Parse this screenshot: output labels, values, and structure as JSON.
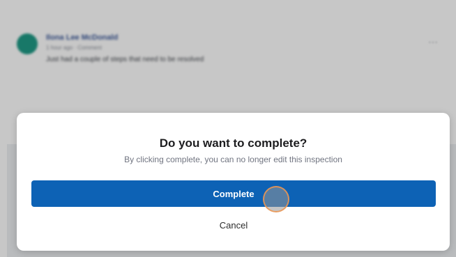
{
  "background": {
    "author": "Ilona Lee McDonald",
    "meta": "1 hour ago · Comment",
    "comment": "Just had a couple of steps that need to be resolved",
    "more_icon": "more-icon"
  },
  "dialog": {
    "title": "Do you want to complete?",
    "subtitle": "By clicking complete, you can no longer edit this inspection",
    "primary_label": "Complete",
    "secondary_label": "Cancel"
  },
  "colors": {
    "primary": "#0d62b5",
    "avatar": "#1f9a86"
  }
}
